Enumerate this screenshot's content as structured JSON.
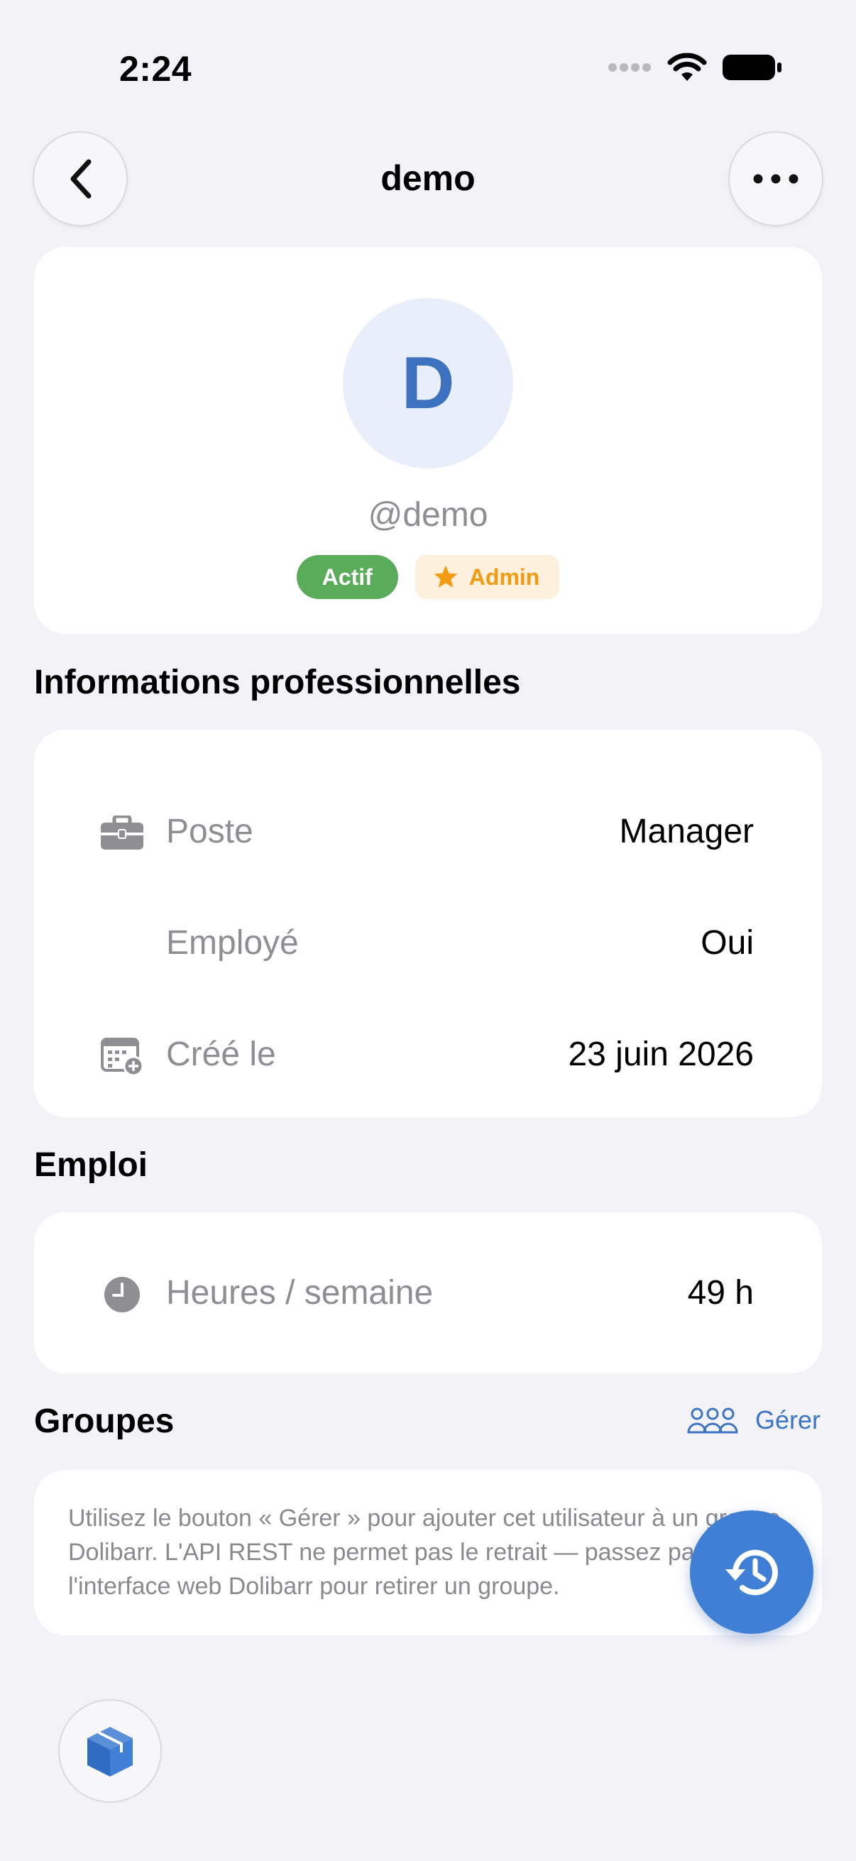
{
  "status_bar": {
    "time": "2:24"
  },
  "nav": {
    "title": "demo"
  },
  "profile": {
    "avatar_letter": "D",
    "username": "@demo",
    "badge_active": "Actif",
    "badge_admin": "Admin"
  },
  "sections": {
    "professional": "Informations professionnelles",
    "employment": "Emploi",
    "groups": "Groupes"
  },
  "professional_rows": [
    {
      "label": "Poste",
      "value": "Manager",
      "icon": "briefcase-icon"
    },
    {
      "label": "Employé",
      "value": "Oui"
    },
    {
      "label": "Créé le",
      "value": "23 juin 2026",
      "icon": "calendar-add-icon"
    }
  ],
  "employment_rows": [
    {
      "label": "Heures / semaine",
      "value": "49 h",
      "icon": "clock-icon"
    }
  ],
  "groups": {
    "manage_label": "Gérer",
    "note": "Utilisez le bouton « Gérer » pour ajouter cet utilisateur à un groupe Dolibarr. L'API REST ne permet pas le retrait — passez par l'interface web Dolibarr pour retirer un groupe."
  },
  "colors": {
    "accent": "#3d74c4",
    "active_badge": "#5aac5a",
    "admin_badge_text": "#f29b12",
    "background": "#f2f2f7"
  }
}
